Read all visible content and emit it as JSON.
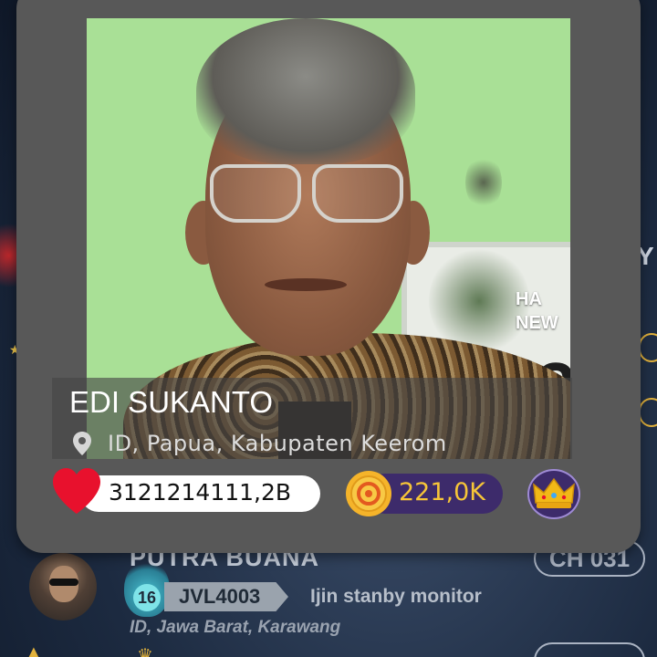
{
  "profile_card": {
    "name": "EDI SUKANTO",
    "location": "ID, Papua, Kabupaten Keerom",
    "likes": "3121214111,2B",
    "coins": "221,0K",
    "photo_poster_text": "HA\nNEW",
    "photo_poster_number": "2"
  },
  "list_row": {
    "name": "PUTRA BUANA",
    "channel": "CH 031",
    "level": "16",
    "tag": "JVL4003",
    "status": "Ijin stanby monitor",
    "location": "ID, Jawa Barat, Karawang"
  },
  "background": {
    "edge_letter": "Y"
  },
  "colors": {
    "card_bg": "#585858",
    "likes_pill": "#ffffff",
    "coin_pill": "#3d2b6b",
    "coin_text": "#f6c538",
    "heart": "#e8112d",
    "crown": "#f2b817"
  },
  "icons": {
    "pin": "location-pin-icon",
    "heart": "heart-icon",
    "coin": "coin-icon",
    "crown": "crown-icon"
  }
}
